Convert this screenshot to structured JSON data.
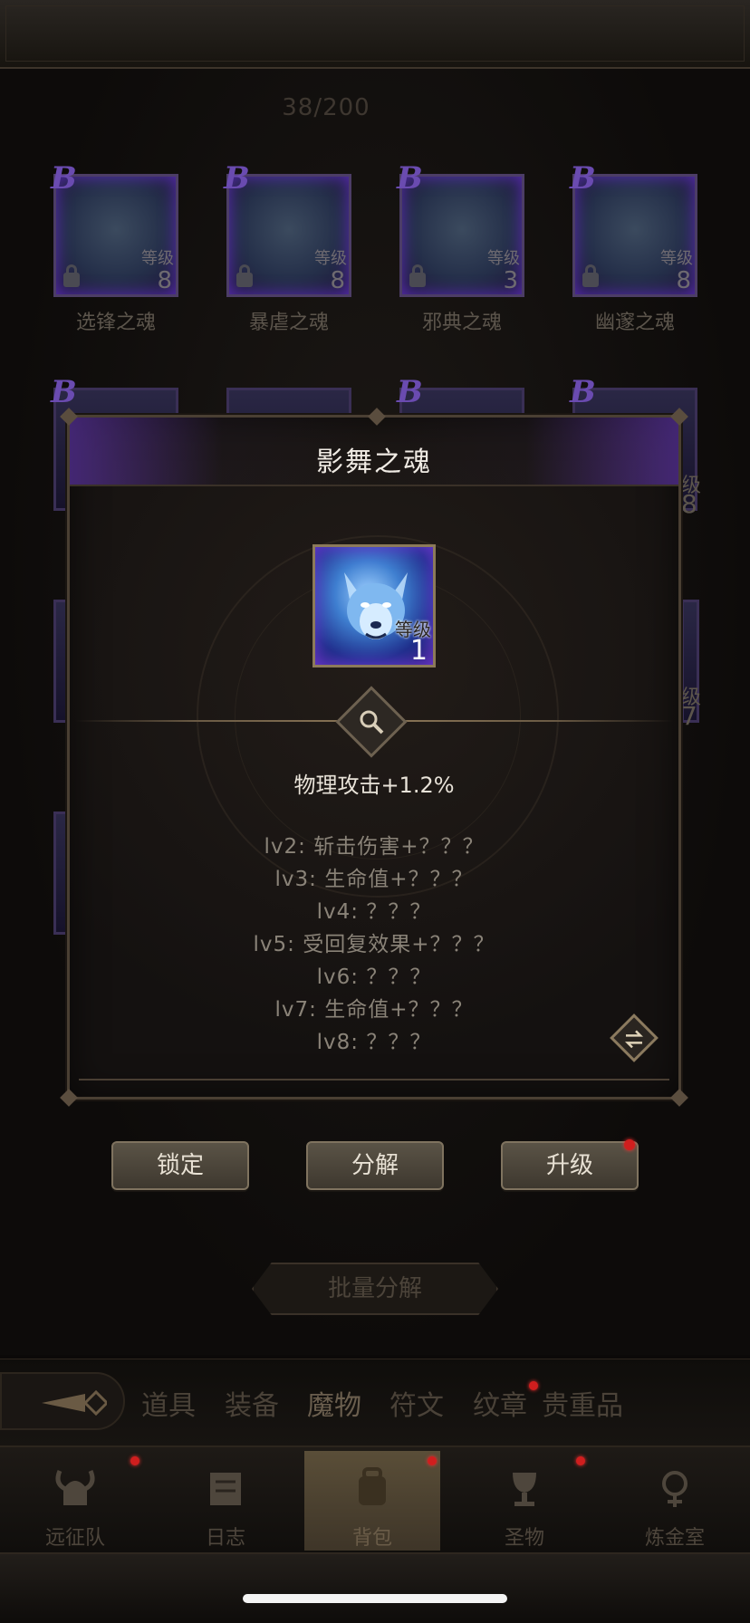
{
  "top": {
    "counter": "38/200"
  },
  "grid": {
    "row1": [
      {
        "name": "选锋之魂",
        "rarity": "B",
        "level_label": "等级",
        "level": "8"
      },
      {
        "name": "暴虐之魂",
        "rarity": "B",
        "level_label": "等级",
        "level": "8"
      },
      {
        "name": "邪典之魂",
        "rarity": "B",
        "level_label": "等级",
        "level": "3"
      },
      {
        "name": "幽邃之魂",
        "rarity": "B",
        "level_label": "等级",
        "level": "8"
      }
    ],
    "row2_rarity": "B",
    "side_peek": {
      "r1_tag": "级",
      "r1_num": "8",
      "r2_tag": "级",
      "r2_num": "7"
    }
  },
  "modal": {
    "title": "影舞之魂",
    "level_label": "等级",
    "level": "1",
    "main_effect": "物理攻击+1.2%",
    "effects": [
      "lv2: 斩击伤害+？？？",
      "lv3: 生命值+？？？",
      "lv4: ？？？",
      "lv5: 受回复效果+？？？",
      "lv6: ？？？",
      "lv7: 生命值+？？？",
      "lv8: ？？？"
    ]
  },
  "actions": {
    "lock": "锁定",
    "decompose": "分解",
    "upgrade": "升级",
    "batch": "批量分解"
  },
  "categories": [
    "道具",
    "装备",
    "魔物",
    "符文",
    "纹章",
    "贵重品"
  ],
  "nav": [
    "远征队",
    "日志",
    "背包",
    "圣物",
    "炼金室"
  ],
  "colors": {
    "accent_purple": "#6a4bb0",
    "badge_red": "#d01e1e",
    "soul_blue": "#3f7fd0"
  }
}
